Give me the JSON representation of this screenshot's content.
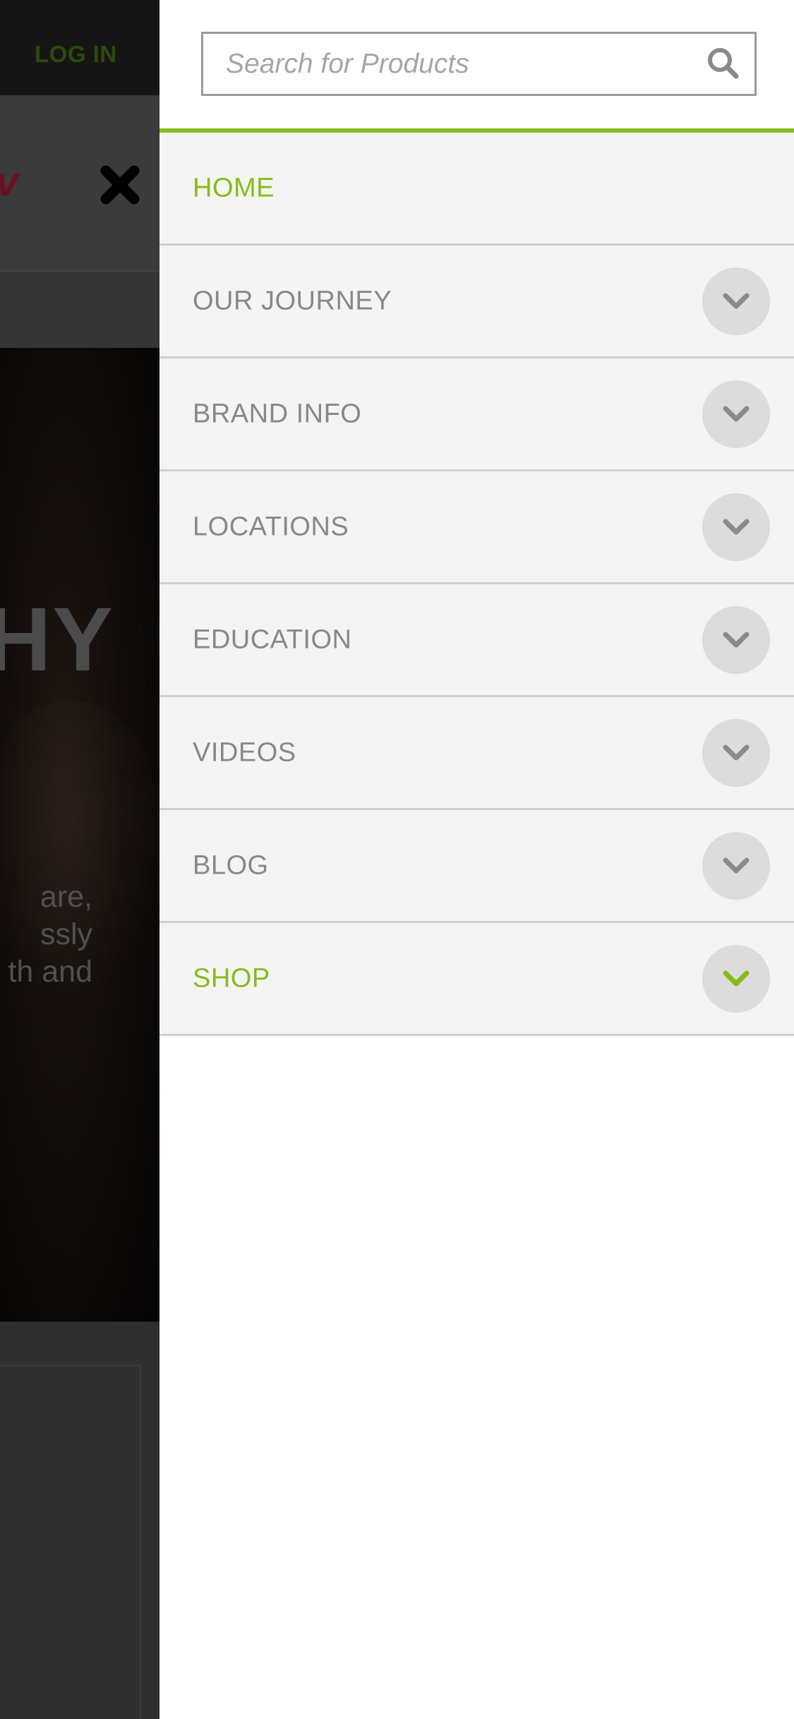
{
  "background_page": {
    "login_label": "LOG IN",
    "hero_title": "HY",
    "hero_text": "are,\nssly\nth and",
    "brand_fragment": "v"
  },
  "search": {
    "placeholder": "Search for Products",
    "value": ""
  },
  "menu": {
    "items": [
      {
        "label": "HOME",
        "expandable": false,
        "active": true
      },
      {
        "label": "OUR JOURNEY",
        "expandable": true,
        "active": false
      },
      {
        "label": "BRAND INFO",
        "expandable": true,
        "active": false
      },
      {
        "label": "LOCATIONS",
        "expandable": true,
        "active": false
      },
      {
        "label": "EDUCATION",
        "expandable": true,
        "active": false
      },
      {
        "label": "VIDEOS",
        "expandable": true,
        "active": false
      },
      {
        "label": "BLOG",
        "expandable": true,
        "active": false
      },
      {
        "label": "SHOP",
        "expandable": true,
        "active": true
      }
    ]
  },
  "icons": {
    "search": "search-icon",
    "close": "close-icon",
    "expand": "chevron-down-icon"
  },
  "colors": {
    "accent": "#86bc1a",
    "menu_text": "#888888",
    "menu_bg": "#f4f4f4",
    "divider": "#cfcfcf",
    "expand_bg": "#dcdcdc",
    "chevron": "#8a8a8a",
    "overlay_bg": "#2c2c2c"
  }
}
